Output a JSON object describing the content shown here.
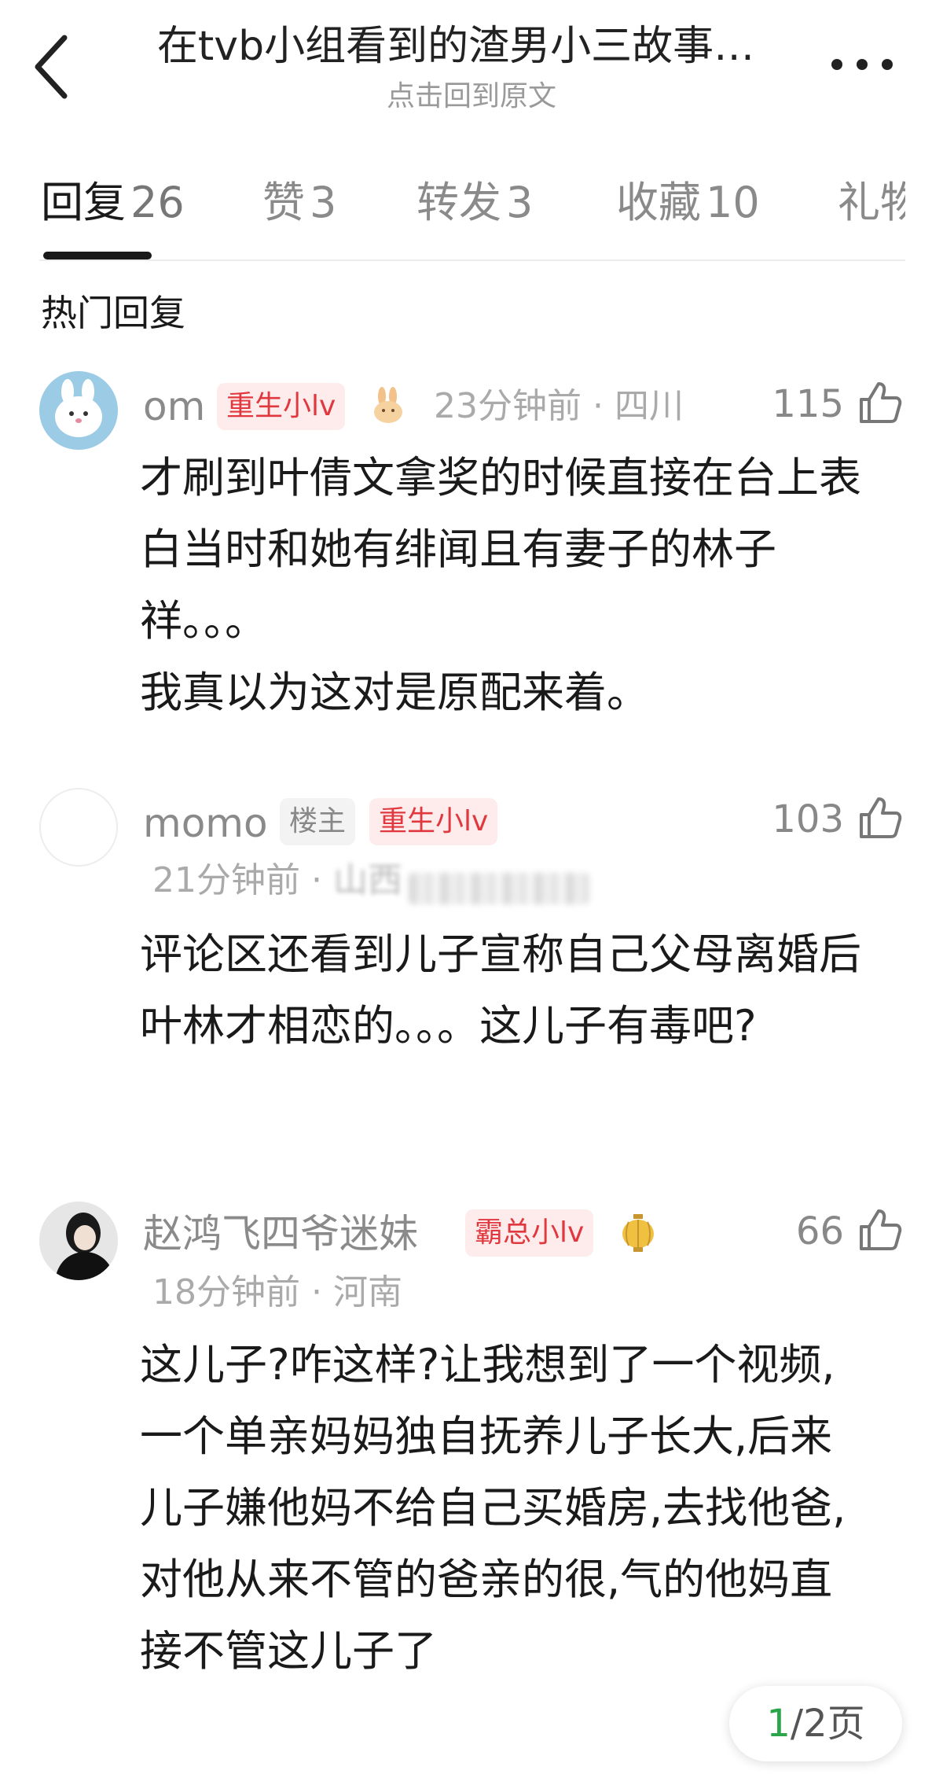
{
  "header": {
    "title": "在tvb小组看到的渣男小三故事…",
    "subtitle": "点击回到原文"
  },
  "tabs": [
    {
      "label": "回复",
      "count": "26",
      "active": true
    },
    {
      "label": "赞",
      "count": "3"
    },
    {
      "label": "转发",
      "count": "3"
    },
    {
      "label": "收藏",
      "count": "10"
    },
    {
      "label": "礼物",
      "count": ""
    }
  ],
  "section_title": "热门回复",
  "comments": [
    {
      "username": "om",
      "badges": [
        "重生小lv"
      ],
      "emoji": "rabbit-icon",
      "time": "23分钟前",
      "location": "四川",
      "likes": "115",
      "text": "才刷到叶倩文拿奖的时候直接在台上表白当时和她有绯闻且有妻子的林子祥。。。\n我真以为这对是原配来着。"
    },
    {
      "username": "momo",
      "badges": [
        "楼主",
        "重生小lv"
      ],
      "time": "21分钟前",
      "location": "山西",
      "likes": "103",
      "text": "评论区还看到儿子宣称自己父母离婚后叶林才相恋的。。。这儿子有毒吧?"
    },
    {
      "username": "赵鸿飞四爷迷妹",
      "badges": [
        "霸总小lv"
      ],
      "emoji": "lantern-icon",
      "time": "18分钟前",
      "location": "河南",
      "likes": "66",
      "text": "这儿子?咋这样?让我想到了一个视频,一个单亲妈妈独自抚养儿子长大,后来儿子嫌他妈不给自己买婚房,去找他爸,对他从来不管的爸亲的很,气的他妈直接不管这儿子了"
    }
  ],
  "pager": {
    "current": "1",
    "rest": "/2页"
  },
  "colors": {
    "accent_red": "#e0383e",
    "pager_green": "#2aa54a"
  }
}
